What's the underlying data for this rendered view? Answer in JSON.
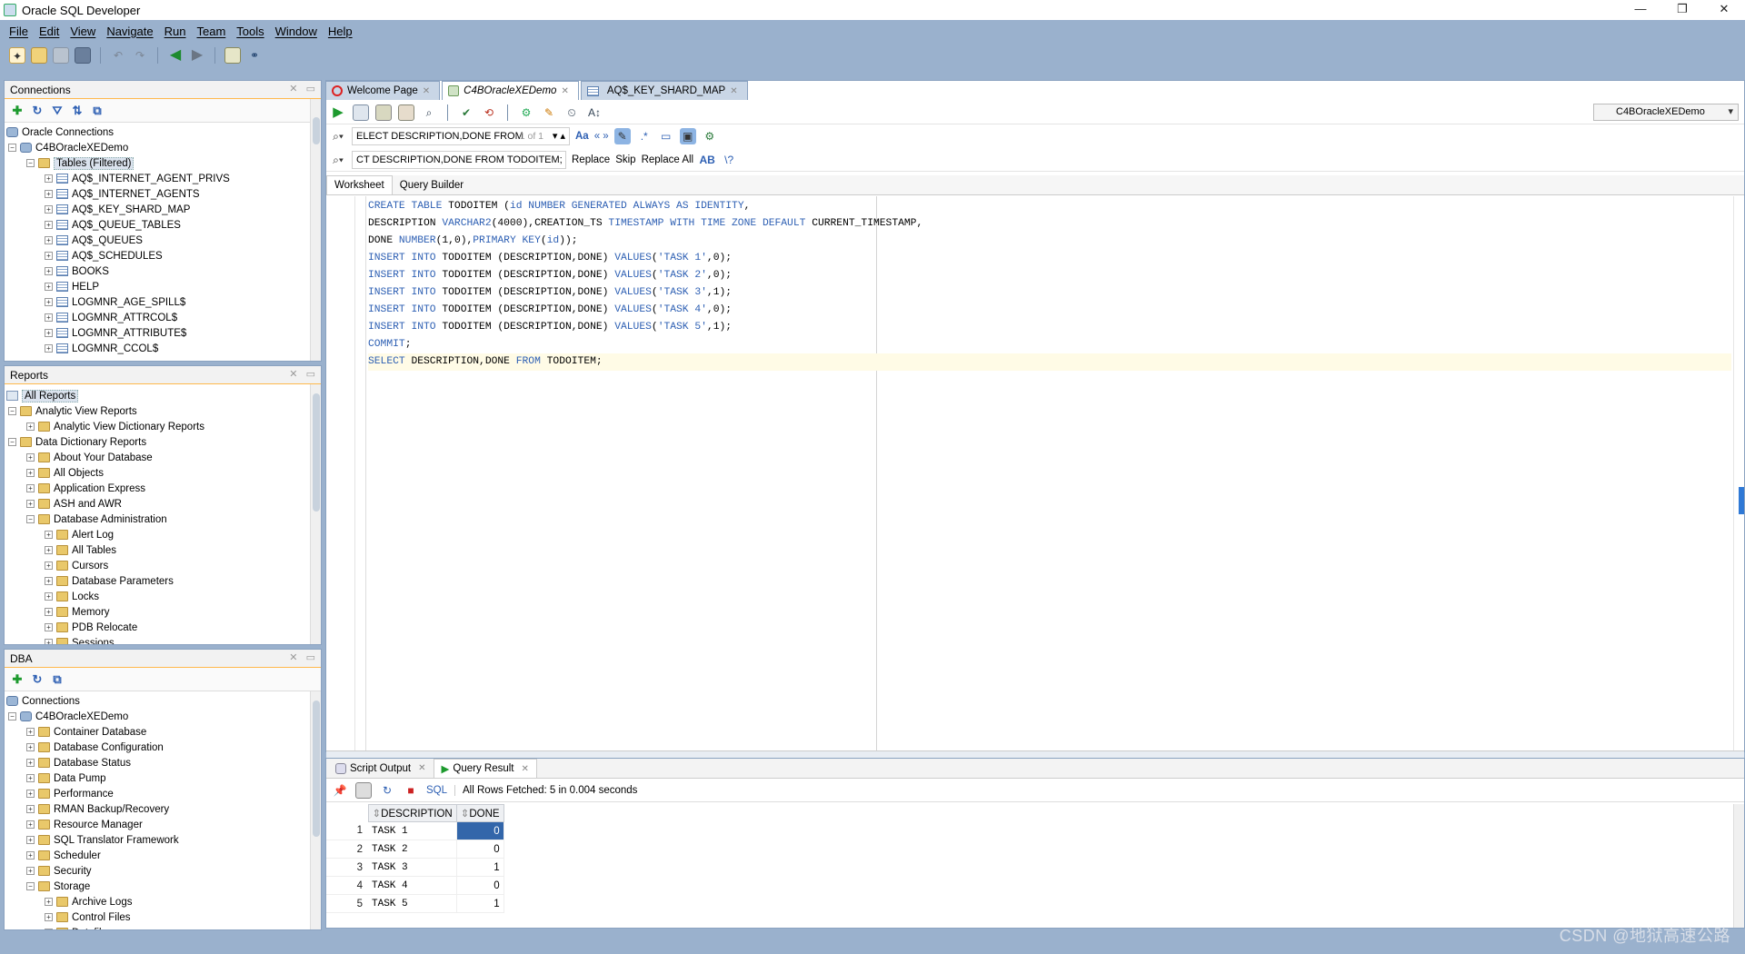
{
  "window": {
    "title": "Oracle SQL Developer",
    "controls": [
      "—",
      "❐",
      "✕"
    ]
  },
  "menu": [
    "File",
    "Edit",
    "View",
    "Navigate",
    "Run",
    "Team",
    "Tools",
    "Window",
    "Help"
  ],
  "connections_panel": {
    "title": "Connections",
    "root": "Oracle Connections",
    "connection": "C4BOracleXEDemo",
    "tables_folder": "Tables (Filtered)",
    "tables": [
      "AQ$_INTERNET_AGENT_PRIVS",
      "AQ$_INTERNET_AGENTS",
      "AQ$_KEY_SHARD_MAP",
      "AQ$_QUEUE_TABLES",
      "AQ$_QUEUES",
      "AQ$_SCHEDULES",
      "BOOKS",
      "HELP",
      "LOGMNR_AGE_SPILL$",
      "LOGMNR_ATTRCOL$",
      "LOGMNR_ATTRIBUTE$",
      "LOGMNR_CCOL$"
    ]
  },
  "reports_panel": {
    "title": "Reports",
    "all_reports": "All Reports",
    "items": [
      {
        "label": "Analytic View Reports",
        "level": 1,
        "state": "open"
      },
      {
        "label": "Analytic View Dictionary Reports",
        "level": 2,
        "state": "closed"
      },
      {
        "label": "Data Dictionary Reports",
        "level": 1,
        "state": "open"
      },
      {
        "label": "About Your Database",
        "level": 2,
        "state": "closed"
      },
      {
        "label": "All Objects",
        "level": 2,
        "state": "closed"
      },
      {
        "label": "Application Express",
        "level": 2,
        "state": "closed"
      },
      {
        "label": "ASH and AWR",
        "level": 2,
        "state": "closed"
      },
      {
        "label": "Database Administration",
        "level": 2,
        "state": "open"
      },
      {
        "label": "Alert Log",
        "level": 3,
        "state": "closed"
      },
      {
        "label": "All Tables",
        "level": 3,
        "state": "closed"
      },
      {
        "label": "Cursors",
        "level": 3,
        "state": "closed"
      },
      {
        "label": "Database Parameters",
        "level": 3,
        "state": "closed"
      },
      {
        "label": "Locks",
        "level": 3,
        "state": "closed"
      },
      {
        "label": "Memory",
        "level": 3,
        "state": "closed"
      },
      {
        "label": "PDB Relocate",
        "level": 3,
        "state": "closed"
      },
      {
        "label": "Sessions",
        "level": 3,
        "state": "closed"
      }
    ]
  },
  "dba_panel": {
    "title": "DBA",
    "root": "Connections",
    "connection": "C4BOracleXEDemo",
    "items": [
      {
        "label": "Container Database",
        "level": 2,
        "state": "closed"
      },
      {
        "label": "Database Configuration",
        "level": 2,
        "state": "closed"
      },
      {
        "label": "Database Status",
        "level": 2,
        "state": "closed"
      },
      {
        "label": "Data Pump",
        "level": 2,
        "state": "closed"
      },
      {
        "label": "Performance",
        "level": 2,
        "state": "closed"
      },
      {
        "label": "RMAN Backup/Recovery",
        "level": 2,
        "state": "closed"
      },
      {
        "label": "Resource Manager",
        "level": 2,
        "state": "closed"
      },
      {
        "label": "SQL Translator Framework",
        "level": 2,
        "state": "closed"
      },
      {
        "label": "Scheduler",
        "level": 2,
        "state": "closed"
      },
      {
        "label": "Security",
        "level": 2,
        "state": "closed"
      },
      {
        "label": "Storage",
        "level": 2,
        "state": "open"
      },
      {
        "label": "Archive Logs",
        "level": 3,
        "state": "closed"
      },
      {
        "label": "Control Files",
        "level": 3,
        "state": "closed"
      },
      {
        "label": "Datafiles",
        "level": 3,
        "state": "closed"
      }
    ]
  },
  "doc_tabs": [
    {
      "label": "Welcome Page",
      "active": false
    },
    {
      "label": "C4BOracleXEDemo",
      "active": true
    },
    {
      "label": "AQ$_KEY_SHARD_MAP",
      "active": false
    }
  ],
  "connection_selector": "C4BOracleXEDemo",
  "find": {
    "text": "ELECT DESCRIPTION,DONE FROM",
    "count": "1 of 1",
    "aa": "Aa",
    "quote": "« »"
  },
  "replace": {
    "text": "CT DESCRIPTION,DONE FROM TODOITEM;",
    "replace": "Replace",
    "skip": "Skip",
    "replace_all": "Replace All"
  },
  "worksheet_tabs": [
    "Worksheet",
    "Query Builder"
  ],
  "code_lines": [
    "CREATE TABLE TODOITEM (id NUMBER GENERATED ALWAYS AS IDENTITY,",
    "DESCRIPTION VARCHAR2(4000),CREATION_TS TIMESTAMP WITH TIME ZONE DEFAULT CURRENT_TIMESTAMP,",
    "DONE NUMBER(1,0),PRIMARY KEY(id));",
    "INSERT INTO TODOITEM (DESCRIPTION,DONE) VALUES('TASK 1',0);",
    "INSERT INTO TODOITEM (DESCRIPTION,DONE) VALUES('TASK 2',0);",
    "INSERT INTO TODOITEM (DESCRIPTION,DONE) VALUES('TASK 3',1);",
    "INSERT INTO TODOITEM (DESCRIPTION,DONE) VALUES('TASK 4',0);",
    "INSERT INTO TODOITEM (DESCRIPTION,DONE) VALUES('TASK 5',1);",
    "COMMIT;",
    "SELECT DESCRIPTION,DONE FROM TODOITEM;"
  ],
  "results": {
    "tabs": [
      {
        "label": "Script Output",
        "active": false
      },
      {
        "label": "Query Result",
        "active": true
      }
    ],
    "sql_label": "SQL",
    "message": "All Rows Fetched: 5 in 0.004 seconds",
    "columns": [
      "DESCRIPTION",
      "DONE"
    ],
    "rows": [
      {
        "n": "1",
        "description": "TASK 1",
        "done": "0"
      },
      {
        "n": "2",
        "description": "TASK 2",
        "done": "0"
      },
      {
        "n": "3",
        "description": "TASK 3",
        "done": "1"
      },
      {
        "n": "4",
        "description": "TASK 4",
        "done": "0"
      },
      {
        "n": "5",
        "description": "TASK 5",
        "done": "1"
      }
    ]
  },
  "watermark": "CSDN @地狱高速公路"
}
